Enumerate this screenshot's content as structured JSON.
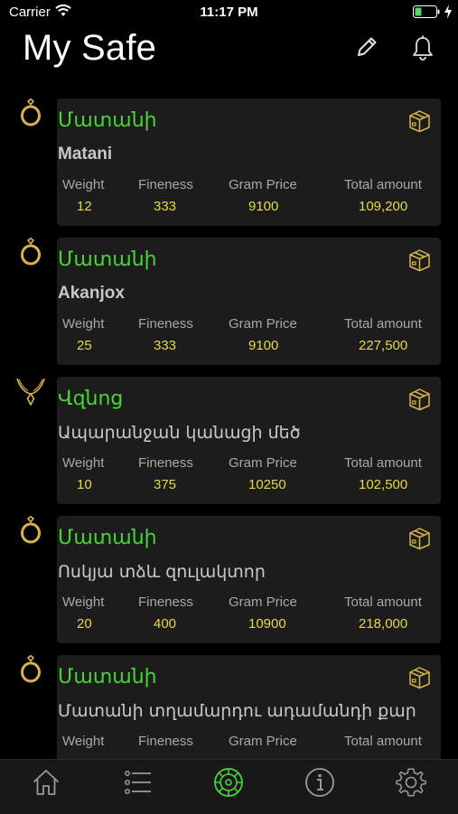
{
  "status_bar": {
    "carrier": "Carrier",
    "time": "11:17 PM",
    "icons": [
      "wifi-icon",
      "battery-icon",
      "charging-icon"
    ]
  },
  "header": {
    "title": "My Safe",
    "actions": [
      "edit-icon",
      "bell-icon"
    ]
  },
  "columns": {
    "weight": "Weight",
    "fineness": "Fineness",
    "gram_price": "Gram Price",
    "total_amount": "Total amount"
  },
  "items": [
    {
      "category": "Մատանի",
      "name": "Matani",
      "icon": "ring-icon",
      "weight": "12",
      "fineness": "333",
      "gram_price": "9100",
      "total_amount": "109,200"
    },
    {
      "category": "Մատանի",
      "name": "Akanjox",
      "icon": "ring-icon",
      "weight": "25",
      "fineness": "333",
      "gram_price": "9100",
      "total_amount": "227,500"
    },
    {
      "category": "Վզնոց",
      "name": "Ապարանջան կանացի մեծ",
      "icon": "necklace-icon",
      "weight": "10",
      "fineness": "375",
      "gram_price": "10250",
      "total_amount": "102,500"
    },
    {
      "category": "Մատանի",
      "name": "Ոսկյա տձև զուլակտոր",
      "icon": "ring-icon",
      "weight": "20",
      "fineness": "400",
      "gram_price": "10900",
      "total_amount": "218,000"
    },
    {
      "category": "Մատանի",
      "name": "Մատանի տղամարդու ադամանդի քար",
      "icon": "ring-icon",
      "weight": "",
      "fineness": "",
      "gram_price": "",
      "total_amount": ""
    }
  ],
  "tab_bar": {
    "tabs": [
      "home-icon",
      "list-icon",
      "safe-icon",
      "info-icon",
      "settings-icon"
    ],
    "active": "safe-icon"
  },
  "colors": {
    "accent_green": "#4bd13c",
    "value_yellow": "#e8d84a",
    "gold_icon": "#d8b24a",
    "card_bg": "#1c1c1c"
  }
}
